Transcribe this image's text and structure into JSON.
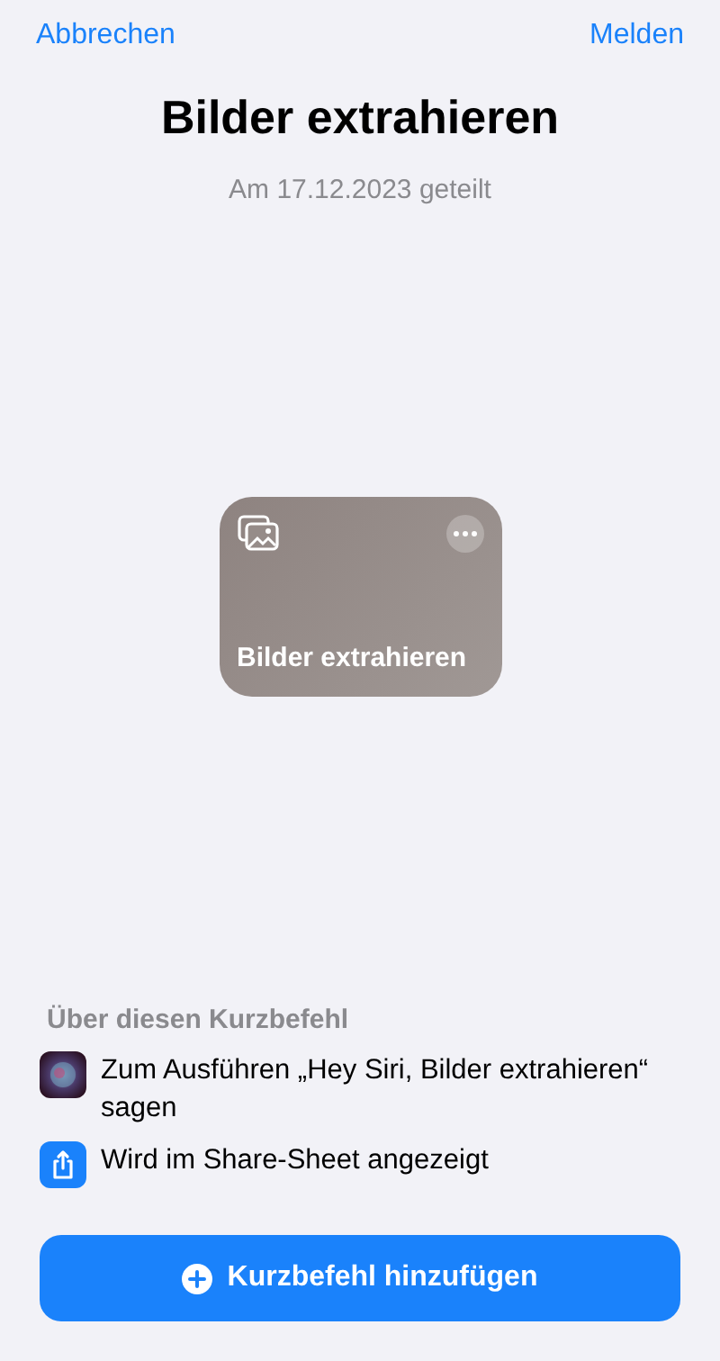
{
  "nav": {
    "cancel": "Abbrechen",
    "report": "Melden"
  },
  "title": "Bilder extrahieren",
  "subtitle": "Am 17.12.2023 geteilt",
  "shortcut_card": {
    "name": "Bilder extrahieren"
  },
  "about": {
    "heading": "Über diesen Kurzbefehl",
    "items": [
      {
        "kind": "siri",
        "text": "Zum Ausführen „Hey Siri, Bilder extrahieren“ sagen"
      },
      {
        "kind": "share",
        "text": "Wird im Share-Sheet angezeigt"
      }
    ]
  },
  "add_button": "Kurzbefehl hinzufügen"
}
